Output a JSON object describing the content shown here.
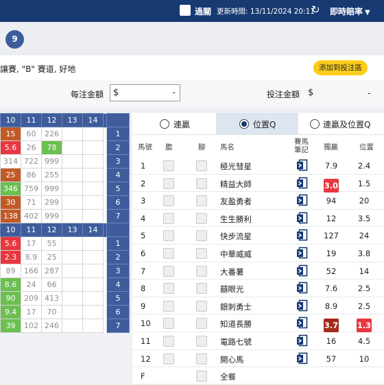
{
  "topbar": {
    "pass_label": "過關",
    "update_time": "更新時間: 13/11/2024 20:11",
    "live_odds": "即時賠率"
  },
  "race": {
    "number": "9",
    "description": "讓賽, \"B\" 賽道, 好地",
    "add_button": "添加到投注區"
  },
  "amount": {
    "unit_label": "每注金額",
    "unit_currency": "$",
    "unit_value": "-",
    "total_label": "投注金額",
    "total_currency": "$",
    "total_value": "-"
  },
  "grid_top": {
    "headers": [
      "10",
      "11",
      "12",
      "13",
      "14"
    ],
    "labels": [
      "1",
      "2",
      "3",
      "4",
      "5",
      "6",
      "7"
    ],
    "rows": [
      [
        "15",
        "60",
        "226",
        "",
        ""
      ],
      [
        "5.6",
        "26",
        "78",
        "",
        ""
      ],
      [
        "314",
        "722",
        "999",
        "",
        ""
      ],
      [
        "25",
        "86",
        "255",
        "",
        ""
      ],
      [
        "346",
        "759",
        "999",
        "",
        ""
      ],
      [
        "30",
        "71",
        "299",
        "",
        ""
      ],
      [
        "138",
        "402",
        "999",
        "",
        ""
      ]
    ]
  },
  "grid_bottom": {
    "headers": [
      "10",
      "11",
      "12",
      "13",
      "14"
    ],
    "labels": [
      "1",
      "2",
      "3",
      "4",
      "5",
      "6",
      "7"
    ],
    "rows": [
      [
        "5.6",
        "17",
        "55",
        "",
        ""
      ],
      [
        "2.3",
        "8.9",
        "25",
        "",
        ""
      ],
      [
        "89",
        "166",
        "287",
        "",
        ""
      ],
      [
        "8.6",
        "24",
        "66",
        "",
        ""
      ],
      [
        "90",
        "209",
        "413",
        "",
        ""
      ],
      [
        "9.4",
        "17",
        "70",
        "",
        ""
      ],
      [
        "39",
        "102",
        "246",
        "",
        ""
      ]
    ]
  },
  "colors": {
    "navy": "#173a73",
    "blue": "#3f5d9c",
    "red": "#e8373f",
    "brown": "#c25a28",
    "green": "#6bbf4f",
    "yellow": "#fbcd1a"
  },
  "tabs": [
    "連贏",
    "位置Q",
    "連贏及位置Q"
  ],
  "table_headers": {
    "no": "馬號",
    "banker": "膽",
    "leg": "腳",
    "name": "馬名",
    "form": "賽馬筆記",
    "win": "獨贏",
    "place": "位置"
  },
  "horses": [
    {
      "no": "1",
      "name": "極光彗星",
      "win": "7.9",
      "place": "2.4"
    },
    {
      "no": "2",
      "name": "精益大師",
      "win": "3.0",
      "place": "1.5"
    },
    {
      "no": "3",
      "name": "友盈勇者",
      "win": "94",
      "place": "20"
    },
    {
      "no": "4",
      "name": "生生勝利",
      "win": "12",
      "place": "3.5"
    },
    {
      "no": "5",
      "name": "快步流星",
      "win": "127",
      "place": "24"
    },
    {
      "no": "6",
      "name": "中華威威",
      "win": "19",
      "place": "3.8"
    },
    {
      "no": "7",
      "name": "大番薯",
      "win": "52",
      "place": "14"
    },
    {
      "no": "8",
      "name": "囍眼光",
      "win": "7.6",
      "place": "2.5"
    },
    {
      "no": "9",
      "name": "銀刺勇士",
      "win": "8.9",
      "place": "2.5"
    },
    {
      "no": "10",
      "name": "知道長勝",
      "win": "3.7",
      "place": "1.3"
    },
    {
      "no": "11",
      "name": "電路七號",
      "win": "16",
      "place": "4.5"
    },
    {
      "no": "12",
      "name": "開心馬",
      "win": "57",
      "place": "10"
    },
    {
      "no": "F",
      "name": "全餐",
      "win": "",
      "place": ""
    }
  ]
}
